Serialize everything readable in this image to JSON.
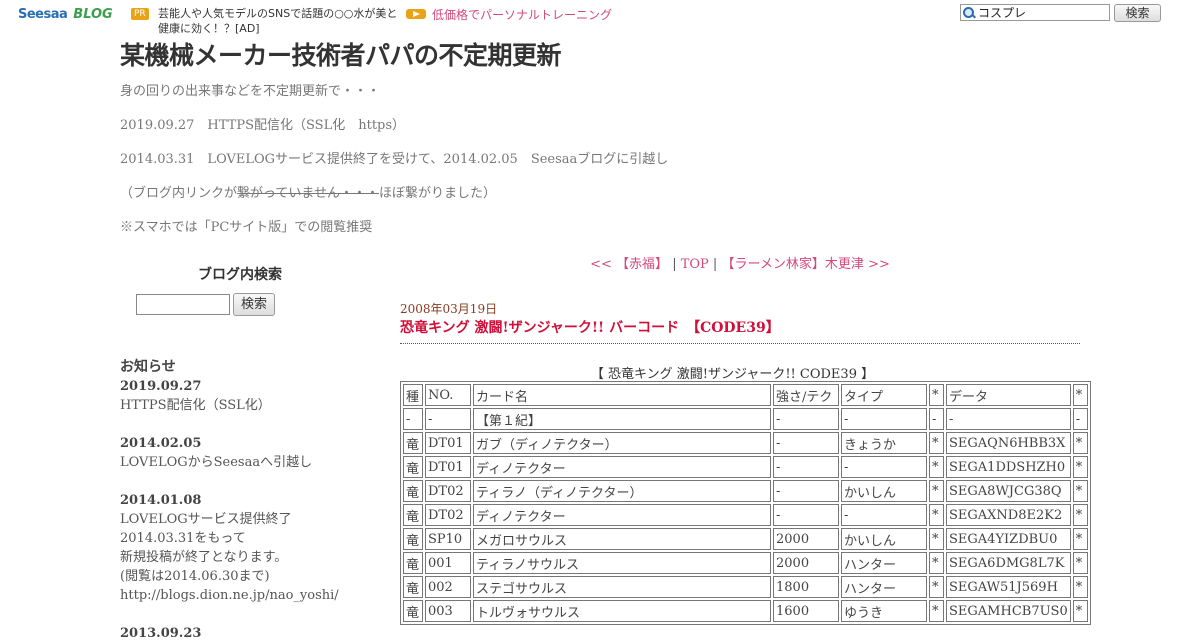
{
  "topbar": {
    "logo_seesaa": "Seesaa",
    "logo_blog": "BLOG",
    "pr_badge": "PR",
    "pr_text": "芸能人や人気モデルのSNSで話題の○○水が美と健康に効く！？[AD]",
    "promo_link": "低価格でパーソナルトレーニング",
    "search_value": "コスプレ",
    "search_button": "検索"
  },
  "header": {
    "title": "某機械メーカー技術者パパの不定期更新",
    "desc1": "身の回りの出来事などを不定期更新で・・・",
    "desc2": "2019.09.27　HTTPS配信化（SSL化　https）",
    "desc3": "2014.03.31　LOVELOGサービス提供終了を受けて、2014.02.05　Seesaaブログに引越し",
    "desc4_a": "（ブログ内リンクが",
    "desc4_strike": "繋がっていません・・・",
    "desc4_b": "ほぼ繋がりました）",
    "desc5": "※スマホでは「PCサイト版」での閲覧推奨"
  },
  "sidebar": {
    "search_title": "ブログ内検索",
    "search_button": "検索",
    "notice_title": "お知らせ",
    "n1_date": "2019.09.27",
    "n1_text": "HTTPS配信化（SSL化）",
    "n2_date": "2014.02.05",
    "n2_text": "LOVELOGからSeesaaへ引越し",
    "n3_date": "2014.01.08",
    "n3_l1": "LOVELOGサービス提供終了",
    "n3_l2": "2014.03.31をもって",
    "n3_l3": "新規投稿が終了となります。",
    "n3_l4": "(閲覧は2014.06.30まで)",
    "n3_l5": "http://blogs.dion.ne.jp/nao_yoshi/",
    "n4_date": "2013.09.23"
  },
  "pager": {
    "prev": "<< 【赤福】",
    "sep1": " | ",
    "top": "TOP",
    "sep2": " | ",
    "next": "【ラーメン林家】木更津 >>"
  },
  "post": {
    "date": "2008年03月19日",
    "title": "恐竜キング 激闘!ザンジャーク!! バーコード　【CODE39】",
    "caption": "【 恐竜キング 激闘!ザンジャーク!! CODE39 】"
  },
  "table": {
    "header": [
      "種",
      "NO.",
      "カード名",
      "強さ/テク",
      "タイプ",
      "*",
      "データ",
      "*"
    ],
    "rows": [
      [
        "-",
        "-",
        "【第１紀】",
        "-",
        "-",
        "-",
        "-",
        "-"
      ],
      [
        "竜",
        "DT01",
        "ガブ（ディノテクター）",
        "-",
        "きょうか",
        "*",
        "SEGAQN6HBB3X",
        "*"
      ],
      [
        "竜",
        "DT01",
        "ディノテクター",
        "-",
        "-",
        "*",
        "SEGA1DDSHZH0",
        "*"
      ],
      [
        "竜",
        "DT02",
        "ティラノ（ディノテクター）",
        "-",
        "かいしん",
        "*",
        "SEGA8WJCG38Q",
        "*"
      ],
      [
        "竜",
        "DT02",
        "ディノテクター",
        "-",
        "-",
        "*",
        "SEGAXND8E2K2",
        "*"
      ],
      [
        "竜",
        "SP10",
        "メガロサウルス",
        "2000",
        "かいしん",
        "*",
        "SEGA4YIZDBU0",
        "*"
      ],
      [
        "竜",
        "001",
        "ティラノサウルス",
        "2000",
        "ハンター",
        "*",
        "SEGA6DMG8L7K",
        "*"
      ],
      [
        "竜",
        "002",
        "ステゴサウルス",
        "1800",
        "ハンター",
        "*",
        "SEGAW51J569H",
        "*"
      ],
      [
        "竜",
        "003",
        "トルヴォサウルス",
        "1600",
        "ゆうき",
        "*",
        "SEGAMHCB7US0",
        "*"
      ]
    ]
  }
}
